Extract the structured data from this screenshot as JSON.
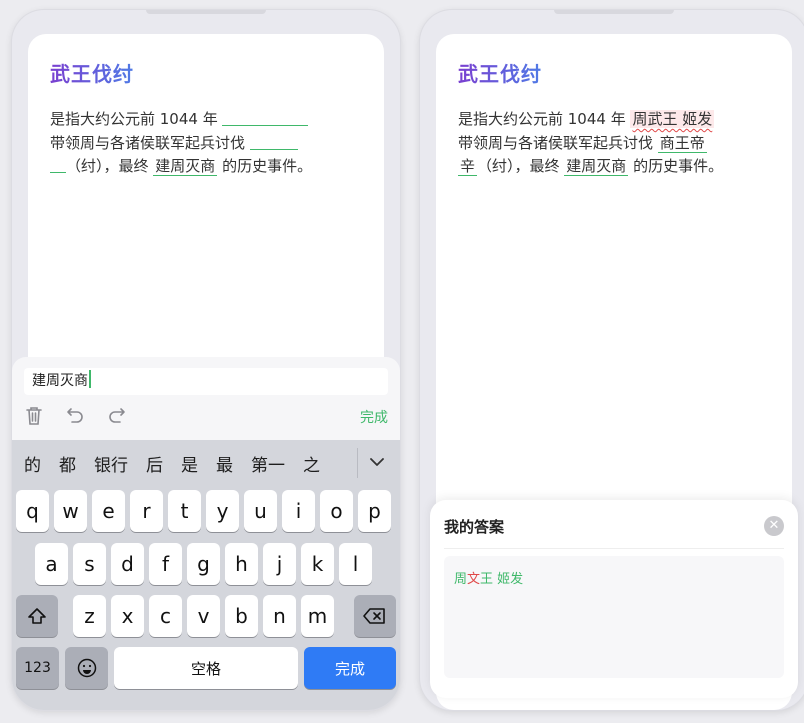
{
  "left": {
    "title": "武王伐纣",
    "passage": {
      "p1": "是指大约公元前 1044 年 ",
      "p2": "带领周与各诸侯联军起兵讨伐 ",
      "p3": "（纣），最终 ",
      "answer3": "建周灭商",
      "p4": " 的历史事件。"
    },
    "input": {
      "value": "建周灭商"
    },
    "toolbar": {
      "delete_icon": "trash-icon",
      "undo_icon": "undo-icon",
      "redo_icon": "redo-icon",
      "done_label": "完成"
    },
    "keyboard": {
      "candidates": [
        "的",
        "都",
        "银行",
        "后",
        "是",
        "最",
        "第一",
        "之"
      ],
      "row1": [
        "q",
        "w",
        "e",
        "r",
        "t",
        "y",
        "u",
        "i",
        "o",
        "p"
      ],
      "row2": [
        "a",
        "s",
        "d",
        "f",
        "g",
        "h",
        "j",
        "k",
        "l"
      ],
      "row3": [
        "z",
        "x",
        "c",
        "v",
        "b",
        "n",
        "m"
      ],
      "num_label": "123",
      "space_label": "空格",
      "done_label": "完成"
    }
  },
  "right": {
    "title": "武王伐纣",
    "passage": {
      "p1": "是指大约公元前 1044 年 ",
      "answer1": "周武王 姬发",
      "p2": "带领周与各诸侯联军起兵讨伐 ",
      "answer2a": "商王帝",
      "answer2b": "辛",
      "p3": "（纣），最终 ",
      "answer3": "建周灭商",
      "p4": " 的历史事件。"
    },
    "sheet": {
      "title": "我的答案",
      "answer_a": "周",
      "answer_wrong": "文",
      "answer_b": "王 姬发"
    }
  },
  "colors": {
    "accent_green": "#3fb86a",
    "error_red": "#e04848",
    "primary_blue": "#2f7bf5",
    "title_purple": "#6a4fd6"
  }
}
